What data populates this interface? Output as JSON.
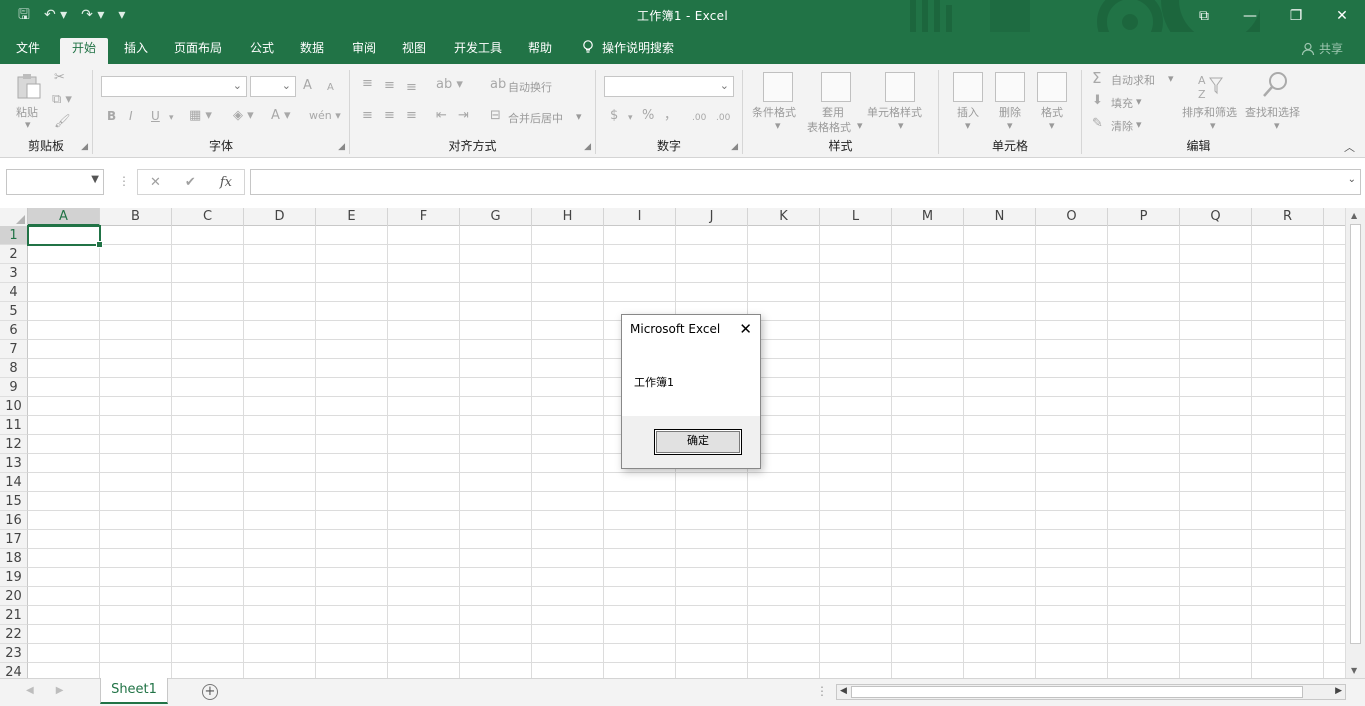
{
  "window": {
    "title": "工作簿1  -  Excel",
    "controls": {
      "ribbon_display": "⧉",
      "minimize": "—",
      "restore": "❐",
      "close": "✕"
    }
  },
  "qat": {
    "save": "🖫",
    "undo": "↶ ▾",
    "redo": "↷ ▾",
    "customize": "▾"
  },
  "menu": {
    "tabs": [
      "文件",
      "开始",
      "插入",
      "页面布局",
      "公式",
      "数据",
      "审阅",
      "视图",
      "开发工具",
      "帮助",
      "操作说明搜索"
    ],
    "active_index": 1,
    "search_icon": "lightbulb-icon",
    "share": "共享"
  },
  "ribbon": {
    "clipboard": {
      "label": "剪贴板",
      "paste": "粘贴"
    },
    "font": {
      "label": "字体",
      "bold": "B",
      "italic": "I",
      "underline": "U",
      "grow": "A",
      "shrink": "A"
    },
    "alignment": {
      "label": "对齐方式",
      "wrap": "自动换行",
      "merge": "合并后居中"
    },
    "number": {
      "label": "数字",
      "currency": "$",
      "percent": "%",
      "comma": "，",
      "inc_decimal": ".00",
      "dec_decimal": ".00"
    },
    "styles": {
      "label": "样式",
      "conditional": "条件格式",
      "table1": "套用",
      "table2": "表格格式",
      "cell_styles": "单元格样式"
    },
    "cells": {
      "label": "单元格",
      "insert": "插入",
      "delete": "删除",
      "format": "格式"
    },
    "editing": {
      "label": "编辑",
      "autosum": "自动求和",
      "fill": "填充",
      "clear": "清除",
      "sort": "排序和筛选",
      "find": "查找和选择"
    }
  },
  "formula_bar": {
    "name_box": "",
    "value": "",
    "cancel": "✕",
    "enter": "✔",
    "fx": "fx"
  },
  "grid": {
    "columns": [
      "A",
      "B",
      "C",
      "D",
      "E",
      "F",
      "G",
      "H",
      "I",
      "J",
      "K",
      "L",
      "M",
      "N",
      "O",
      "P",
      "Q",
      "R"
    ],
    "rows": [
      "1",
      "2",
      "3",
      "4",
      "5",
      "6",
      "7",
      "8",
      "9",
      "10",
      "11",
      "12",
      "13",
      "14",
      "15",
      "16",
      "17",
      "18",
      "19",
      "20",
      "21",
      "22",
      "23",
      "24"
    ],
    "selected_cell": "A1"
  },
  "sheets": {
    "tabs": [
      "Sheet1"
    ],
    "active": "Sheet1",
    "add": "+"
  },
  "dialog": {
    "title": "Microsoft Excel",
    "message": "工作簿1",
    "ok": "确定",
    "close": "✕"
  },
  "colors": {
    "brand": "#217346",
    "ribbon_bg": "#f3f3f3"
  }
}
